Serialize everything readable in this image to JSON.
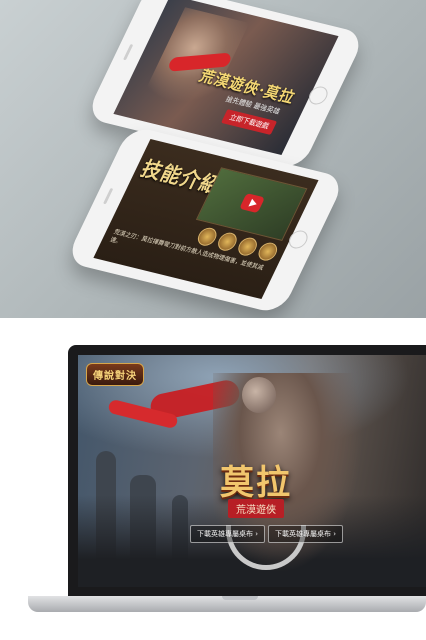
{
  "phone1": {
    "title": "荒漠遊俠·莫拉",
    "subtitle": "搶先體驗 最強英雄",
    "download_label": "立即下載遊戲"
  },
  "phone2": {
    "title": "技能介紹",
    "description": "荒漠之刃：莫拉揮舞彎刀對前方敵人造成物理傷害，並使其減速。"
  },
  "laptop": {
    "logo": "傳說對決",
    "hero_name": "莫拉",
    "hero_subtitle": "荒漠遊俠",
    "download_left": "下載英雄專屬桌布 ›",
    "download_right": "下載英雄專屬桌布 ›"
  },
  "colors": {
    "accent_red": "#c81f23",
    "gold": "#f1c66d"
  }
}
